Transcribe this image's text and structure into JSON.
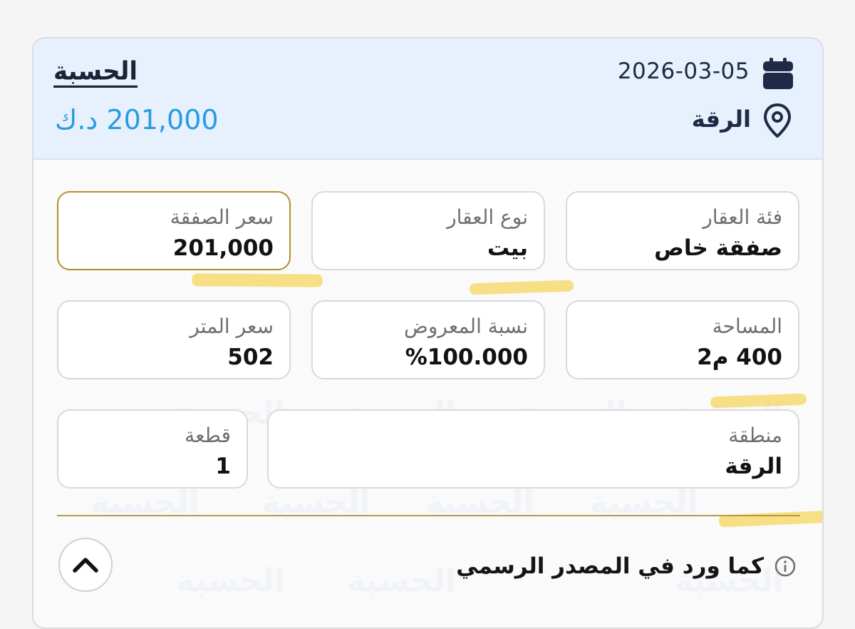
{
  "header": {
    "date": "2026-03-05",
    "location": "الرقة",
    "logo": "الحسبة",
    "price": "201,000 د.ك"
  },
  "details": {
    "property_category": {
      "label": "فئة العقار",
      "value": "صفقة خاص"
    },
    "property_type": {
      "label": "نوع العقار",
      "value": "بيت"
    },
    "deal_price": {
      "label": "سعر الصفقة",
      "value": "201,000"
    },
    "area": {
      "label": "المساحة",
      "value": "400 م2"
    },
    "offered_ratio": {
      "label": "نسبة المعروض",
      "value": "%100.000"
    },
    "price_per_meter": {
      "label": "سعر المتر",
      "value": "502"
    },
    "region": {
      "label": "منطقة",
      "value": "الرقة"
    },
    "plot": {
      "label": "قطعة",
      "value": "1"
    }
  },
  "footer": {
    "note": "كما ورد في المصدر الرسمي"
  },
  "colors": {
    "header_bg": "#e6f1fd",
    "price": "#2b9be0",
    "gold_accent": "#b38f2b",
    "highlight": "#f6d65e"
  },
  "icons": {
    "date": "calendar-icon",
    "location": "map-pin-icon",
    "note": "info-icon",
    "toggle": "chevron-up-icon"
  }
}
